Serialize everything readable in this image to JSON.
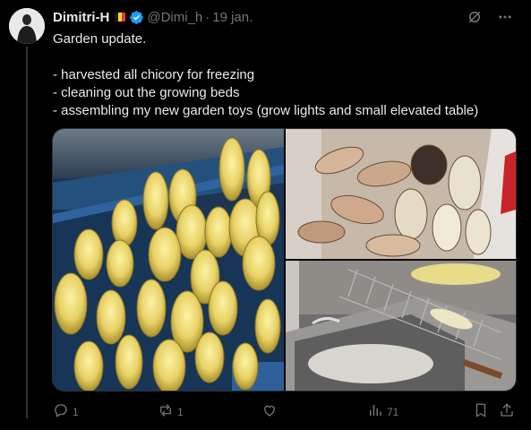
{
  "tweet": {
    "author_name": "Dimitri-H",
    "handle": "@Dimi_h",
    "separator": "·",
    "date": "19 jan.",
    "text_lines": [
      "Garden update.",
      "",
      "- harvested all chicory for freezing",
      "- cleaning out the growing beds",
      "- assembling my new garden toys (grow lights and small elevated table)"
    ]
  },
  "icons": {
    "flag": "belgium-flag-icon",
    "verified": "verified-badge-icon",
    "grok": "grok-icon",
    "more": "more-icon",
    "reply": "reply-icon",
    "retweet": "retweet-icon",
    "like": "like-icon",
    "views": "views-icon",
    "bookmark": "bookmark-icon",
    "share": "share-icon"
  },
  "colors": {
    "background": "#000000",
    "text": "#e7e9ea",
    "muted": "#71767b",
    "verified": "#1d9bf0",
    "flag": [
      "#1a1a1a",
      "#fdda24",
      "#ef3340"
    ]
  },
  "actions": {
    "reply_count": "1",
    "retweet_count": "1",
    "like_count": "",
    "views_count": "71"
  }
}
